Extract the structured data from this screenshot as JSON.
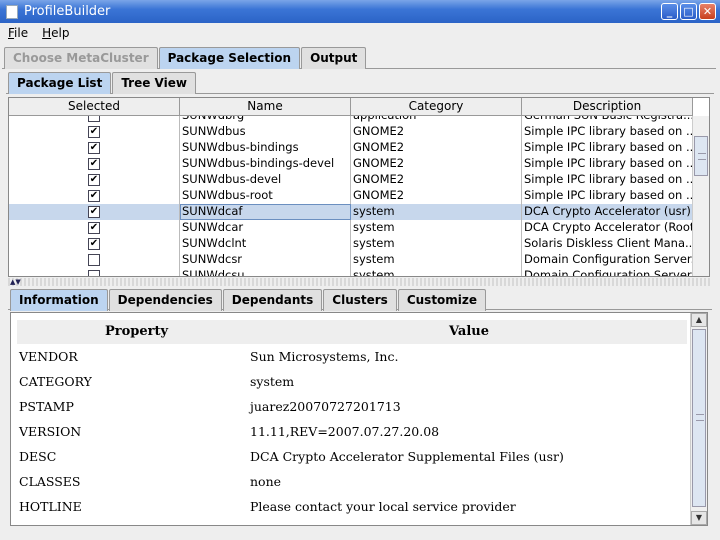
{
  "window": {
    "title": "ProfileBuilder"
  },
  "menu": [
    "File",
    "Help"
  ],
  "main_tabs": [
    {
      "label": "Choose MetaCluster",
      "state": "disabled"
    },
    {
      "label": "Package Selection",
      "state": "active"
    },
    {
      "label": "Output",
      "state": "normal"
    }
  ],
  "sub_tabs": [
    {
      "label": "Package List",
      "state": "active"
    },
    {
      "label": "Tree View",
      "state": "normal"
    }
  ],
  "table": {
    "columns": [
      "Selected",
      "Name",
      "Category",
      "Description"
    ],
    "rows": [
      {
        "checked": false,
        "name": "SUNWdbrg",
        "category": "application",
        "description": "German SUN Basic Registra..."
      },
      {
        "checked": true,
        "name": "SUNWdbus",
        "category": "GNOME2",
        "description": "Simple IPC library based on ..."
      },
      {
        "checked": true,
        "name": "SUNWdbus-bindings",
        "category": "GNOME2",
        "description": "Simple IPC library based on ..."
      },
      {
        "checked": true,
        "name": "SUNWdbus-bindings-devel",
        "category": "GNOME2",
        "description": "Simple IPC library based on ..."
      },
      {
        "checked": true,
        "name": "SUNWdbus-devel",
        "category": "GNOME2",
        "description": "Simple IPC library based on ..."
      },
      {
        "checked": true,
        "name": "SUNWdbus-root",
        "category": "GNOME2",
        "description": "Simple IPC library based on ..."
      },
      {
        "checked": true,
        "name": "SUNWdcaf",
        "category": "system",
        "description": "DCA Crypto Accelerator (usr)",
        "selected": true
      },
      {
        "checked": true,
        "name": "SUNWdcar",
        "category": "system",
        "description": "DCA Crypto Accelerator (Root)"
      },
      {
        "checked": true,
        "name": "SUNWdclnt",
        "category": "system",
        "description": "Solaris Diskless Client Mana..."
      },
      {
        "checked": false,
        "name": "SUNWdcsr",
        "category": "system",
        "description": "Domain Configuration Server..."
      },
      {
        "checked": false,
        "name": "SUNWdcsu",
        "category": "system",
        "description": "Domain Configuration Server..."
      }
    ]
  },
  "detail_tabs": [
    {
      "label": "Information",
      "state": "active"
    },
    {
      "label": "Dependencies",
      "state": "normal"
    },
    {
      "label": "Dependants",
      "state": "normal"
    },
    {
      "label": "Clusters",
      "state": "normal"
    },
    {
      "label": "Customize",
      "state": "normal"
    }
  ],
  "info": {
    "header_property": "Property",
    "header_value": "Value",
    "rows": [
      {
        "property": "VENDOR",
        "value": "Sun Microsystems, Inc."
      },
      {
        "property": "CATEGORY",
        "value": "system"
      },
      {
        "property": "PSTAMP",
        "value": "juarez20070727201713"
      },
      {
        "property": "VERSION",
        "value": "11.11,REV=2007.07.27.20.08"
      },
      {
        "property": "DESC",
        "value": "DCA Crypto Accelerator Supplemental Files (usr)"
      },
      {
        "property": "CLASSES",
        "value": "none"
      },
      {
        "property": "HOTLINE",
        "value": "Please contact your local service provider"
      }
    ]
  },
  "icons": {
    "check": "✔",
    "minimize": "_",
    "maximize": "□",
    "close": "✕",
    "scroll_up": "▲",
    "scroll_down": "▼"
  }
}
